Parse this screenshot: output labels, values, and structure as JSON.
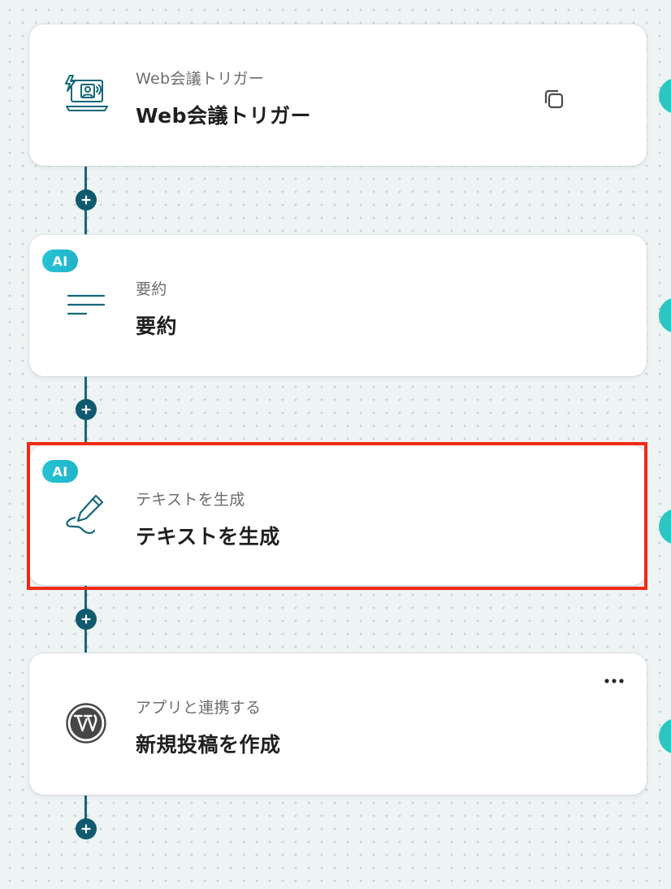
{
  "flow": {
    "steps": [
      {
        "subtitle": "Web会議トリガー",
        "title": "Web会議トリガー",
        "icon": "web-meeting-icon",
        "badge": null,
        "action": "copy-icon"
      },
      {
        "subtitle": "要約",
        "title": "要約",
        "icon": "summary-lines-icon",
        "badge": "AI",
        "action": null
      },
      {
        "subtitle": "テキストを生成",
        "title": "テキストを生成",
        "icon": "pen-icon",
        "badge": "AI",
        "action": null,
        "selected": true
      },
      {
        "subtitle": "アプリと連携する",
        "title": "新規投稿を作成",
        "icon": "wordpress-icon",
        "badge": null,
        "action": "more-icon"
      }
    ]
  },
  "colors": {
    "accent": "#13677a",
    "ai_badge": "#27c3d6",
    "highlight": "#f02a12",
    "side_handle": "#2cc6c2"
  }
}
